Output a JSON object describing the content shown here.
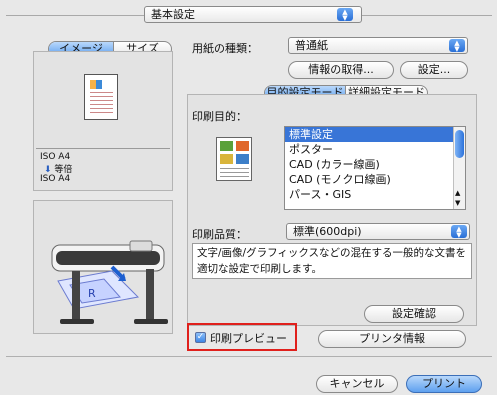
{
  "top_popup": {
    "value": "基本設定"
  },
  "tabs": {
    "image": "イメージ",
    "size": "サイズ"
  },
  "paper_type": {
    "label": "用紙の種類：",
    "value": "普通紙"
  },
  "buttons": {
    "get_info": "情報の取得...",
    "settings": "設定...",
    "confirm_settings": "設定確認",
    "printer_info": "プリンタ情報",
    "cancel": "キャンセル",
    "print": "プリント"
  },
  "mode_tabs": {
    "purpose_mode": "目的設定モード",
    "detail_mode": "詳細設定モード"
  },
  "purpose": {
    "label": "印刷目的：",
    "items": [
      "標準設定",
      "ポスター",
      "CAD (カラー線画)",
      "CAD (モノクロ線画)",
      "パース・GIS"
    ],
    "selected_index": 0
  },
  "size_info": {
    "paper": "ISO A4",
    "scale": "等倍",
    "output": "ISO A4"
  },
  "quality": {
    "label": "印刷品質：",
    "value": "標準(600dpi)"
  },
  "description": "文字/画像/グラフィックスなどの混在する一般的な文書を適切な設定で印刷します。",
  "preview_checkbox": {
    "label": "印刷プレビュー",
    "checked": true
  },
  "colors": {
    "selection": "#3875d7",
    "highlight_box": "#e0201c",
    "accent_blue": "#5ea0ef"
  }
}
